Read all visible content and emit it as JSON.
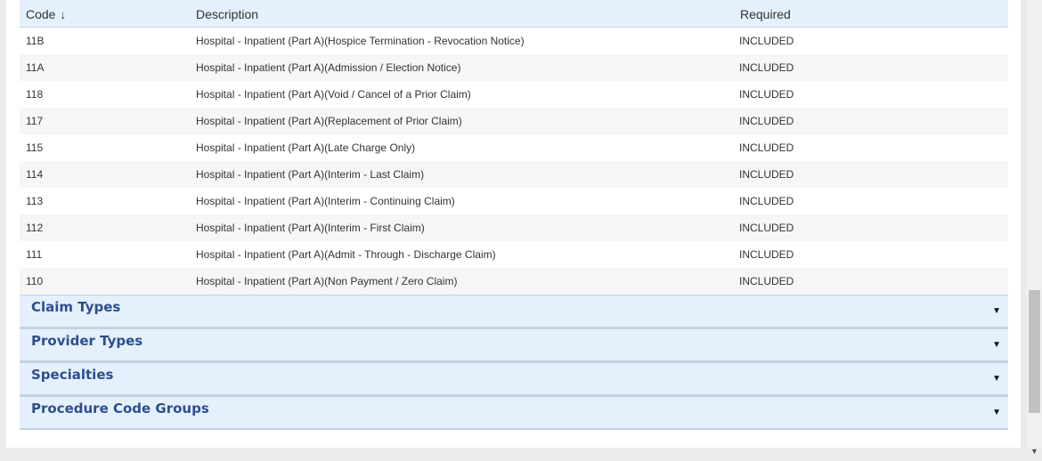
{
  "table": {
    "headers": {
      "code": "Code",
      "description": "Description",
      "required": "Required"
    },
    "sort_icon": "arrow-down-icon",
    "rows": [
      {
        "code": "11B",
        "description": "Hospital - Inpatient (Part A)(Hospice Termination - Revocation Notice)",
        "required": "INCLUDED"
      },
      {
        "code": "11A",
        "description": "Hospital - Inpatient (Part A)(Admission / Election Notice)",
        "required": "INCLUDED"
      },
      {
        "code": "118",
        "description": "Hospital - Inpatient (Part A)(Void / Cancel of a Prior Claim)",
        "required": "INCLUDED"
      },
      {
        "code": "117",
        "description": "Hospital - Inpatient (Part A)(Replacement of Prior Claim)",
        "required": "INCLUDED"
      },
      {
        "code": "115",
        "description": "Hospital - Inpatient (Part A)(Late Charge Only)",
        "required": "INCLUDED"
      },
      {
        "code": "114",
        "description": "Hospital - Inpatient (Part A)(Interim - Last Claim)",
        "required": "INCLUDED"
      },
      {
        "code": "113",
        "description": "Hospital - Inpatient (Part A)(Interim - Continuing Claim)",
        "required": "INCLUDED"
      },
      {
        "code": "112",
        "description": "Hospital - Inpatient (Part A)(Interim - First Claim)",
        "required": "INCLUDED"
      },
      {
        "code": "111",
        "description": "Hospital - Inpatient (Part A)(Admit - Through - Discharge Claim)",
        "required": "INCLUDED"
      },
      {
        "code": "110",
        "description": "Hospital - Inpatient (Part A)(Non Payment / Zero Claim)",
        "required": "INCLUDED"
      }
    ]
  },
  "sections": [
    {
      "title": "Claim Types",
      "icon": "caret-down-icon"
    },
    {
      "title": "Provider Types",
      "icon": "caret-down-icon"
    },
    {
      "title": "Specialties",
      "icon": "caret-down-icon"
    },
    {
      "title": "Procedure Code Groups",
      "icon": "caret-down-icon"
    }
  ],
  "colors": {
    "header_bg": "#e4f0fb",
    "section_title": "#2d4f8e"
  }
}
